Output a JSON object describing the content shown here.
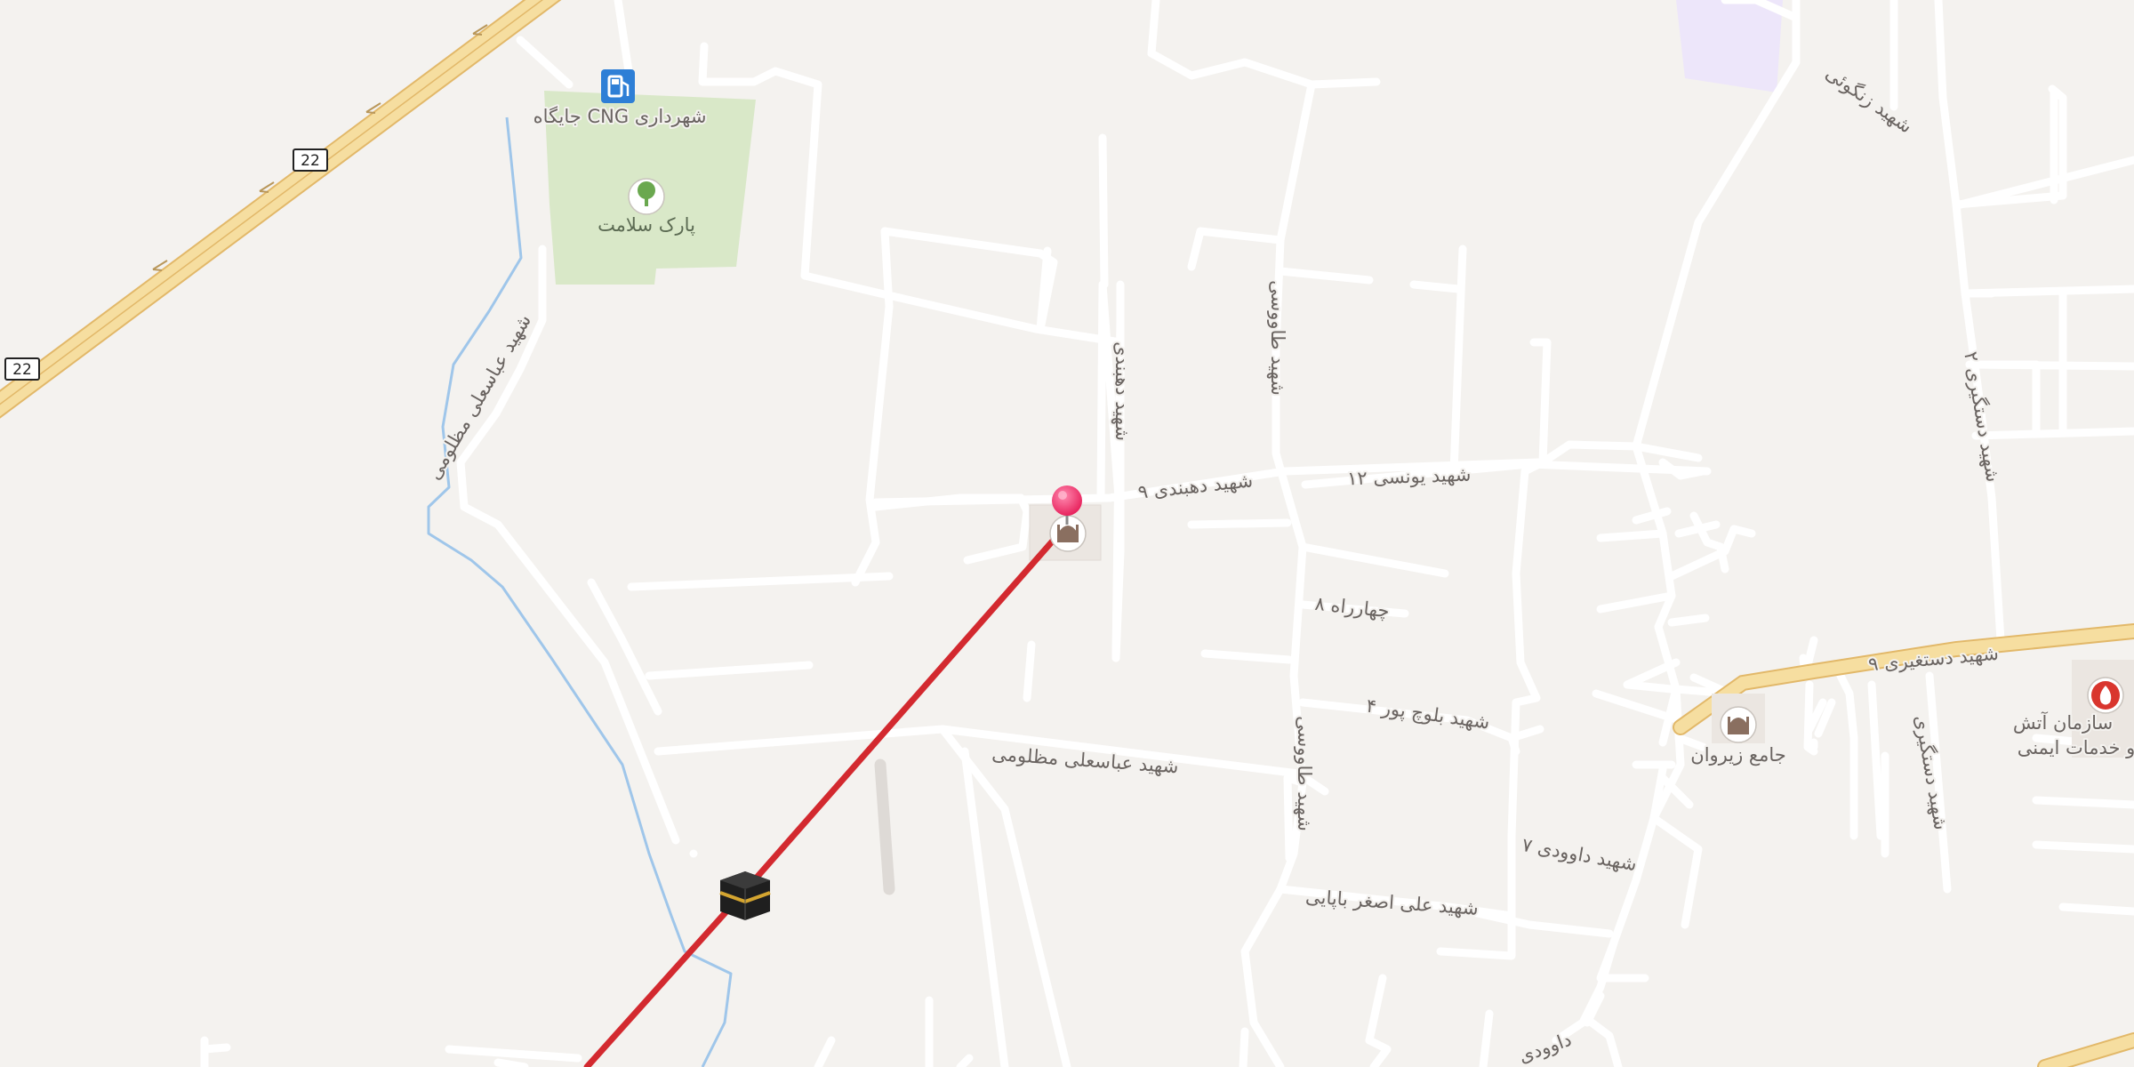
{
  "map": {
    "colors": {
      "background": "#f4f2ef",
      "road": "#ffffff",
      "road_casing": "#dedad6",
      "highway": "#f6dea0",
      "highway_casing": "#e2b869",
      "park": "#d9e8c8",
      "water": "#9fc6ea",
      "route": "#d3292f",
      "pin": "#e8245e",
      "violet_area": "#ede6fa"
    },
    "highway_shield": "22",
    "pois": {
      "cng_station": "جایگاه CNG شهرداری",
      "park": "پارک سلامت",
      "mosque_right": "جامع زیروان",
      "fire_station_line1": "سازمان آتش",
      "fire_station_line2": "و خدمات ایمنی"
    },
    "streets": {
      "abbas_ali_diag": "شهید عباسعلی مظلومی",
      "abbas_ali_main": "شهید عباسعلی مظلومی",
      "dehbandi_vertical": "شهید دهبندی",
      "dehbandi_9": "شهید دهبندی ۹",
      "younesi_12": "شهید یونسی ۱۲",
      "tavoosi_upper": "شهید طاووسی",
      "tavoosi_lower": "شهید طاووسی",
      "chaharrah_8": "چهارراه ۸",
      "baluchpour_4": "شهید بلوچ پور ۴",
      "ali_asghar": "شهید علی اصغر باپایی",
      "davoodi_7": "شهید داوودی ۷",
      "davoodi_bottom": "داوودی",
      "mostaghasi_9": "شهید دستغیری ۹",
      "pasdaran_2": "شهید دستگیری ۲",
      "shahid_diag_top": "شهید زنگوئی",
      "shahid_vertical_right": "شهید دستگیری"
    },
    "icons": {
      "fuel": "fuel-station-icon",
      "park": "tree-icon",
      "mosque": "mosque-icon",
      "kaaba": "kaaba-icon",
      "pin": "location-pin-icon",
      "fire": "fire-station-icon"
    }
  }
}
